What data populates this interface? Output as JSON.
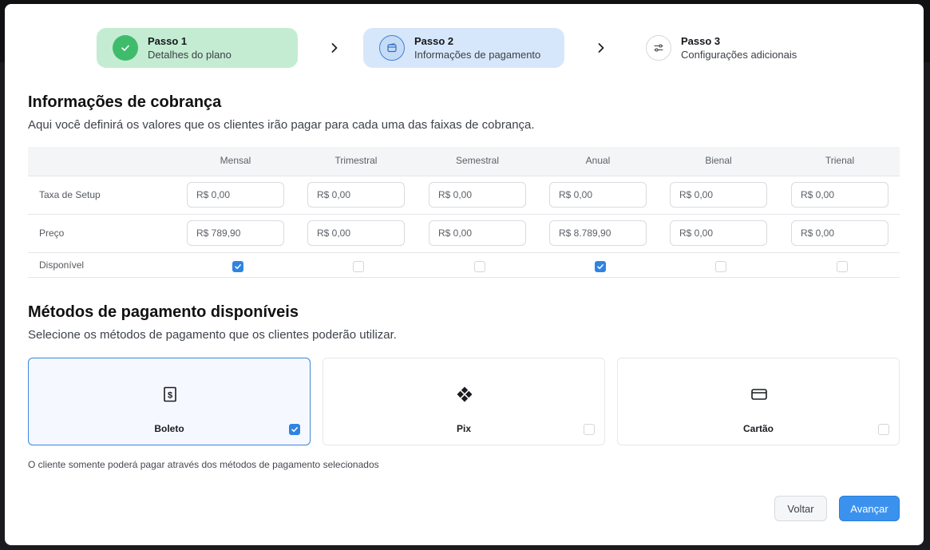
{
  "stepper": {
    "steps": [
      {
        "title": "Passo 1",
        "subtitle": "Detalhes do plano",
        "state": "done"
      },
      {
        "title": "Passo 2",
        "subtitle": "Informações de pagamento",
        "state": "active"
      },
      {
        "title": "Passo 3",
        "subtitle": "Configurações adicionais",
        "state": "pending"
      }
    ]
  },
  "billing": {
    "title": "Informações de cobrança",
    "subtitle": "Aqui você definirá os valores que os clientes irão pagar para cada uma das faixas de cobrança.",
    "columns": [
      "Mensal",
      "Trimestral",
      "Semestral",
      "Anual",
      "Bienal",
      "Trienal"
    ],
    "rows": {
      "setup": {
        "label": "Taxa de Setup",
        "values": [
          "R$ 0,00",
          "R$ 0,00",
          "R$ 0,00",
          "R$ 0,00",
          "R$ 0,00",
          "R$ 0,00"
        ]
      },
      "price": {
        "label": "Preço",
        "values": [
          "R$ 789,90",
          "R$ 0,00",
          "R$ 0,00",
          "R$ 8.789,90",
          "R$ 0,00",
          "R$ 0,00"
        ]
      },
      "available": {
        "label": "Disponível",
        "values": [
          true,
          false,
          false,
          true,
          false,
          false
        ]
      }
    }
  },
  "payment_methods": {
    "title": "Métodos de pagamento disponíveis",
    "subtitle": "Selecione os métodos de pagamento que os clientes poderão utilizar.",
    "methods": [
      {
        "label": "Boleto",
        "icon": "boleto-dollar-icon",
        "checked": true
      },
      {
        "label": "Pix",
        "icon": "pix-icon",
        "checked": false
      },
      {
        "label": "Cartão",
        "icon": "credit-card-icon",
        "checked": false
      }
    ],
    "note": "O cliente somente poderá pagar através dos métodos de pagamento selecionados"
  },
  "footer": {
    "back_label": "Voltar",
    "next_label": "Avançar"
  },
  "colors": {
    "accent": "#3b92ee",
    "success": "#3fbc6b",
    "step_done_bg": "#c4ecd3",
    "step_active_bg": "#d7e7fb"
  }
}
